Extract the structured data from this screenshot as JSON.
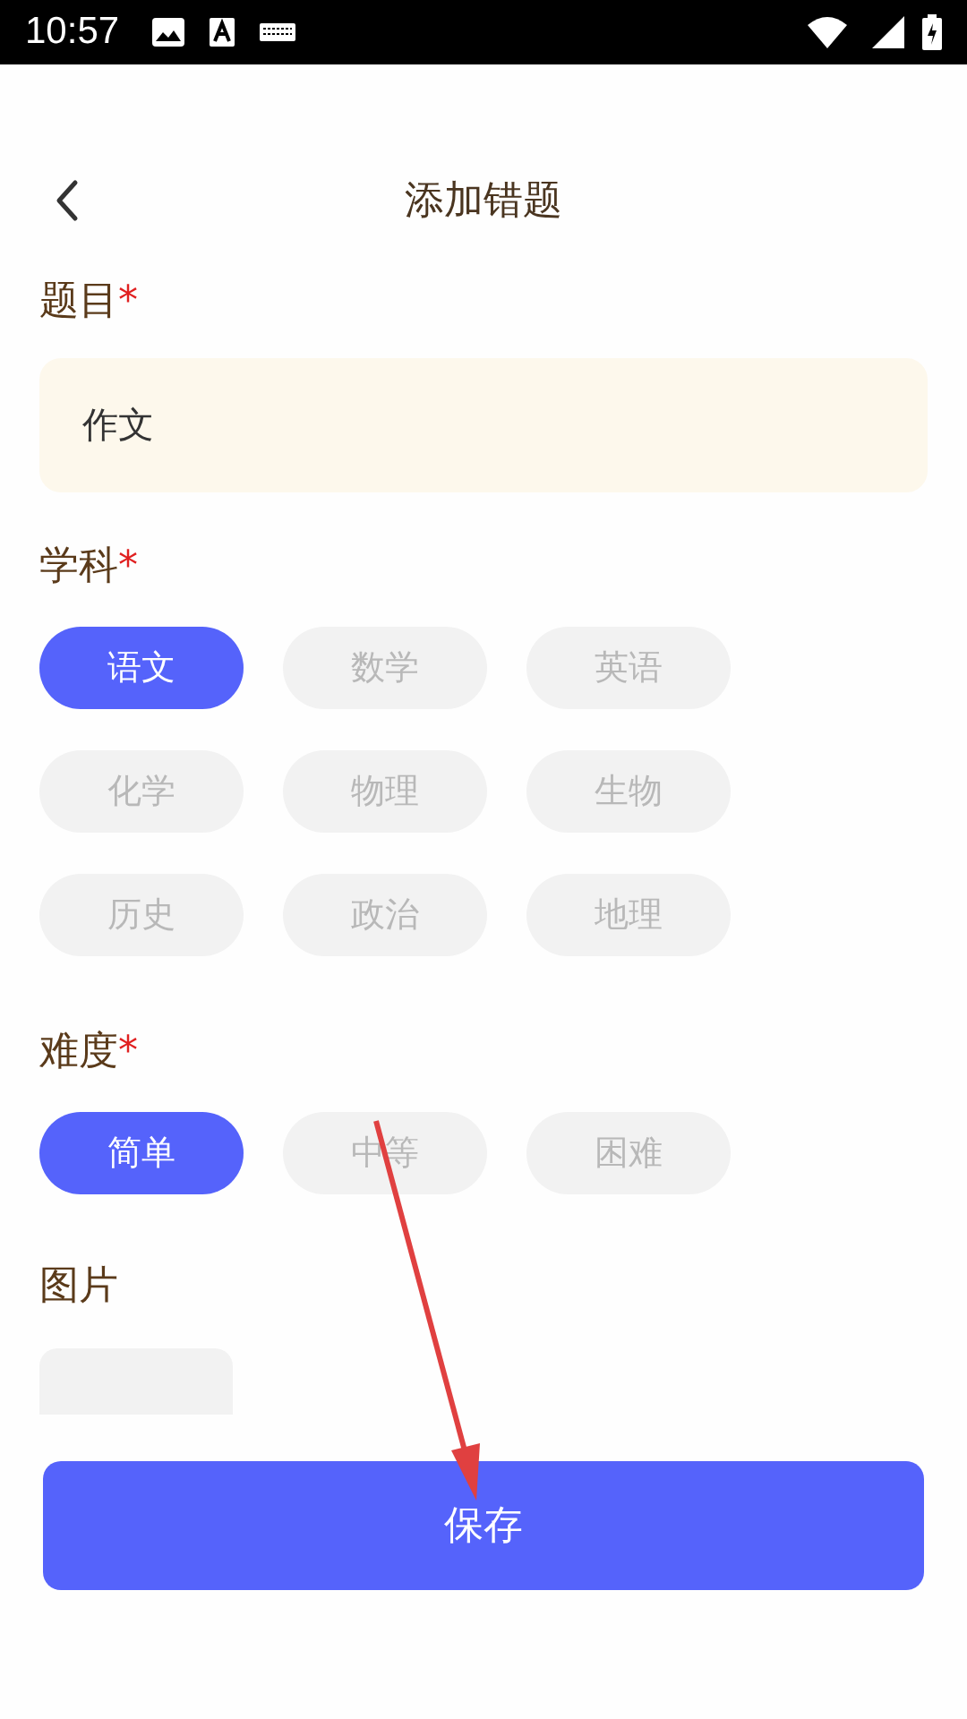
{
  "status_bar": {
    "time": "10:57"
  },
  "header": {
    "title": "添加错题"
  },
  "sections": [
    {
      "kind": "field",
      "label": "题目",
      "required_mark": "*",
      "value": "作文"
    },
    {
      "kind": "chips",
      "label": "学科",
      "required_mark": "*",
      "options": [
        {
          "label": "语文",
          "selected": true
        },
        {
          "label": "数学",
          "selected": false
        },
        {
          "label": "英语",
          "selected": false
        },
        {
          "label": "化学",
          "selected": false
        },
        {
          "label": "物理",
          "selected": false
        },
        {
          "label": "生物",
          "selected": false
        },
        {
          "label": "历史",
          "selected": false
        },
        {
          "label": "政治",
          "selected": false
        },
        {
          "label": "地理",
          "selected": false
        }
      ]
    },
    {
      "kind": "chips",
      "label": "难度",
      "required_mark": "*",
      "options": [
        {
          "label": "简单",
          "selected": true
        },
        {
          "label": "中等",
          "selected": false
        },
        {
          "label": "困难",
          "selected": false
        }
      ]
    },
    {
      "kind": "images",
      "label": "图片"
    }
  ],
  "save_button": {
    "label": "保存"
  }
}
